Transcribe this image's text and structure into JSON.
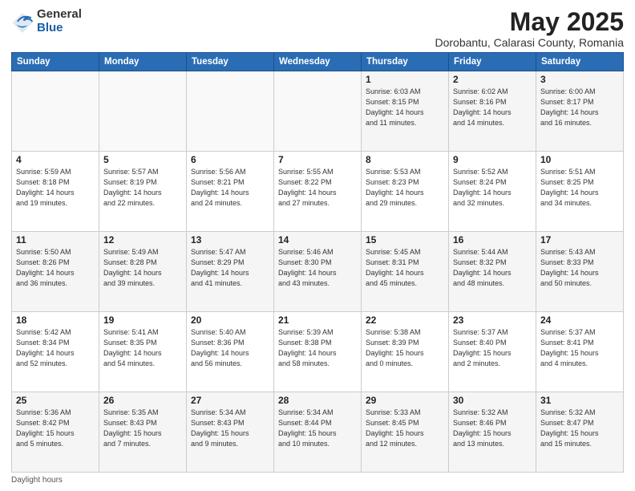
{
  "logo": {
    "general": "General",
    "blue": "Blue"
  },
  "title": {
    "month": "May 2025",
    "location": "Dorobantu, Calarasi County, Romania"
  },
  "headers": [
    "Sunday",
    "Monday",
    "Tuesday",
    "Wednesday",
    "Thursday",
    "Friday",
    "Saturday"
  ],
  "weeks": [
    [
      {
        "day": "",
        "info": ""
      },
      {
        "day": "",
        "info": ""
      },
      {
        "day": "",
        "info": ""
      },
      {
        "day": "",
        "info": ""
      },
      {
        "day": "1",
        "info": "Sunrise: 6:03 AM\nSunset: 8:15 PM\nDaylight: 14 hours\nand 11 minutes."
      },
      {
        "day": "2",
        "info": "Sunrise: 6:02 AM\nSunset: 8:16 PM\nDaylight: 14 hours\nand 14 minutes."
      },
      {
        "day": "3",
        "info": "Sunrise: 6:00 AM\nSunset: 8:17 PM\nDaylight: 14 hours\nand 16 minutes."
      }
    ],
    [
      {
        "day": "4",
        "info": "Sunrise: 5:59 AM\nSunset: 8:18 PM\nDaylight: 14 hours\nand 19 minutes."
      },
      {
        "day": "5",
        "info": "Sunrise: 5:57 AM\nSunset: 8:19 PM\nDaylight: 14 hours\nand 22 minutes."
      },
      {
        "day": "6",
        "info": "Sunrise: 5:56 AM\nSunset: 8:21 PM\nDaylight: 14 hours\nand 24 minutes."
      },
      {
        "day": "7",
        "info": "Sunrise: 5:55 AM\nSunset: 8:22 PM\nDaylight: 14 hours\nand 27 minutes."
      },
      {
        "day": "8",
        "info": "Sunrise: 5:53 AM\nSunset: 8:23 PM\nDaylight: 14 hours\nand 29 minutes."
      },
      {
        "day": "9",
        "info": "Sunrise: 5:52 AM\nSunset: 8:24 PM\nDaylight: 14 hours\nand 32 minutes."
      },
      {
        "day": "10",
        "info": "Sunrise: 5:51 AM\nSunset: 8:25 PM\nDaylight: 14 hours\nand 34 minutes."
      }
    ],
    [
      {
        "day": "11",
        "info": "Sunrise: 5:50 AM\nSunset: 8:26 PM\nDaylight: 14 hours\nand 36 minutes."
      },
      {
        "day": "12",
        "info": "Sunrise: 5:49 AM\nSunset: 8:28 PM\nDaylight: 14 hours\nand 39 minutes."
      },
      {
        "day": "13",
        "info": "Sunrise: 5:47 AM\nSunset: 8:29 PM\nDaylight: 14 hours\nand 41 minutes."
      },
      {
        "day": "14",
        "info": "Sunrise: 5:46 AM\nSunset: 8:30 PM\nDaylight: 14 hours\nand 43 minutes."
      },
      {
        "day": "15",
        "info": "Sunrise: 5:45 AM\nSunset: 8:31 PM\nDaylight: 14 hours\nand 45 minutes."
      },
      {
        "day": "16",
        "info": "Sunrise: 5:44 AM\nSunset: 8:32 PM\nDaylight: 14 hours\nand 48 minutes."
      },
      {
        "day": "17",
        "info": "Sunrise: 5:43 AM\nSunset: 8:33 PM\nDaylight: 14 hours\nand 50 minutes."
      }
    ],
    [
      {
        "day": "18",
        "info": "Sunrise: 5:42 AM\nSunset: 8:34 PM\nDaylight: 14 hours\nand 52 minutes."
      },
      {
        "day": "19",
        "info": "Sunrise: 5:41 AM\nSunset: 8:35 PM\nDaylight: 14 hours\nand 54 minutes."
      },
      {
        "day": "20",
        "info": "Sunrise: 5:40 AM\nSunset: 8:36 PM\nDaylight: 14 hours\nand 56 minutes."
      },
      {
        "day": "21",
        "info": "Sunrise: 5:39 AM\nSunset: 8:38 PM\nDaylight: 14 hours\nand 58 minutes."
      },
      {
        "day": "22",
        "info": "Sunrise: 5:38 AM\nSunset: 8:39 PM\nDaylight: 15 hours\nand 0 minutes."
      },
      {
        "day": "23",
        "info": "Sunrise: 5:37 AM\nSunset: 8:40 PM\nDaylight: 15 hours\nand 2 minutes."
      },
      {
        "day": "24",
        "info": "Sunrise: 5:37 AM\nSunset: 8:41 PM\nDaylight: 15 hours\nand 4 minutes."
      }
    ],
    [
      {
        "day": "25",
        "info": "Sunrise: 5:36 AM\nSunset: 8:42 PM\nDaylight: 15 hours\nand 5 minutes."
      },
      {
        "day": "26",
        "info": "Sunrise: 5:35 AM\nSunset: 8:43 PM\nDaylight: 15 hours\nand 7 minutes."
      },
      {
        "day": "27",
        "info": "Sunrise: 5:34 AM\nSunset: 8:43 PM\nDaylight: 15 hours\nand 9 minutes."
      },
      {
        "day": "28",
        "info": "Sunrise: 5:34 AM\nSunset: 8:44 PM\nDaylight: 15 hours\nand 10 minutes."
      },
      {
        "day": "29",
        "info": "Sunrise: 5:33 AM\nSunset: 8:45 PM\nDaylight: 15 hours\nand 12 minutes."
      },
      {
        "day": "30",
        "info": "Sunrise: 5:32 AM\nSunset: 8:46 PM\nDaylight: 15 hours\nand 13 minutes."
      },
      {
        "day": "31",
        "info": "Sunrise: 5:32 AM\nSunset: 8:47 PM\nDaylight: 15 hours\nand 15 minutes."
      }
    ]
  ],
  "footer": {
    "note": "Daylight hours"
  }
}
